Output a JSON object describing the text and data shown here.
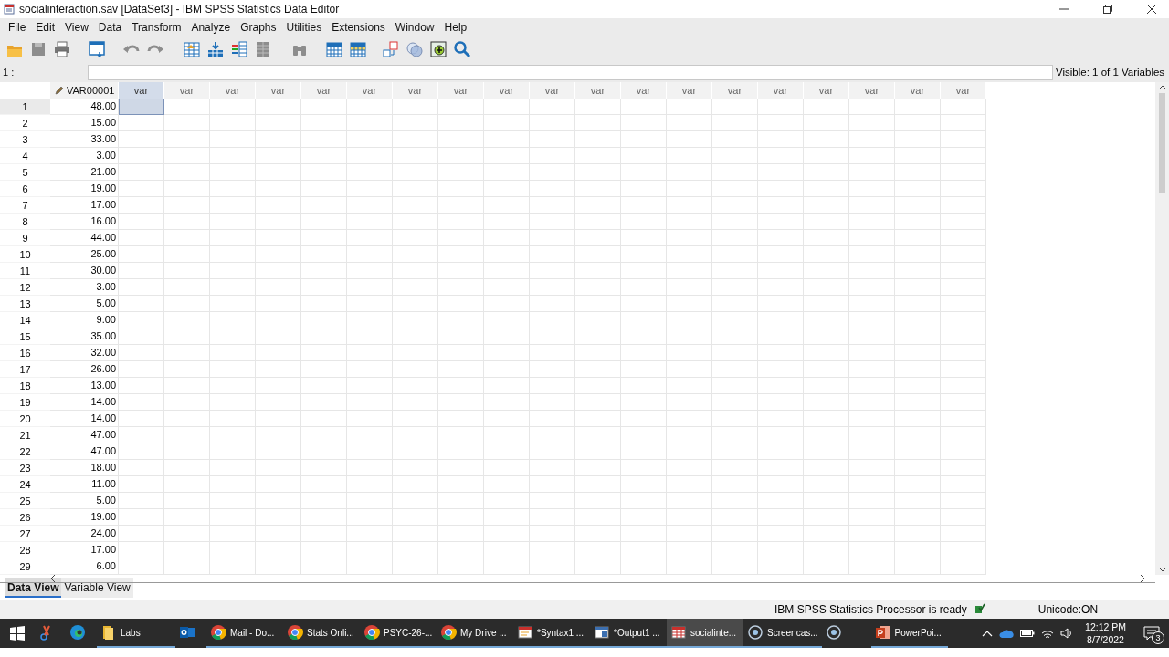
{
  "window": {
    "title": "socialinteraction.sav [DataSet3] - IBM SPSS Statistics Data Editor"
  },
  "menu": [
    "File",
    "Edit",
    "View",
    "Data",
    "Transform",
    "Analyze",
    "Graphs",
    "Utilities",
    "Extensions",
    "Window",
    "Help"
  ],
  "cell_editor": {
    "label": "1 :",
    "visible_count": "Visible: 1 of 1 Variables"
  },
  "grid": {
    "columns": [
      {
        "label": "VAR00001",
        "kind": "variable",
        "selected": false
      },
      {
        "label": "var",
        "kind": "empty",
        "selected": true
      },
      {
        "label": "var",
        "kind": "empty",
        "selected": false
      },
      {
        "label": "var",
        "kind": "empty",
        "selected": false
      },
      {
        "label": "var",
        "kind": "empty",
        "selected": false
      },
      {
        "label": "var",
        "kind": "empty",
        "selected": false
      },
      {
        "label": "var",
        "kind": "empty",
        "selected": false
      },
      {
        "label": "var",
        "kind": "empty",
        "selected": false
      },
      {
        "label": "var",
        "kind": "empty",
        "selected": false
      },
      {
        "label": "var",
        "kind": "empty",
        "selected": false
      },
      {
        "label": "var",
        "kind": "empty",
        "selected": false
      },
      {
        "label": "var",
        "kind": "empty",
        "selected": false
      },
      {
        "label": "var",
        "kind": "empty",
        "selected": false
      },
      {
        "label": "var",
        "kind": "empty",
        "selected": false
      },
      {
        "label": "var",
        "kind": "empty",
        "selected": false
      },
      {
        "label": "var",
        "kind": "empty",
        "selected": false
      },
      {
        "label": "var",
        "kind": "empty",
        "selected": false
      },
      {
        "label": "var",
        "kind": "empty",
        "selected": false
      },
      {
        "label": "var",
        "kind": "empty",
        "selected": false
      },
      {
        "label": "var",
        "kind": "empty",
        "selected": false
      }
    ],
    "rows": [
      {
        "number": "1",
        "value": "48.00",
        "selected": true
      },
      {
        "number": "2",
        "value": "15.00",
        "selected": false
      },
      {
        "number": "3",
        "value": "33.00",
        "selected": false
      },
      {
        "number": "4",
        "value": "3.00",
        "selected": false
      },
      {
        "number": "5",
        "value": "21.00",
        "selected": false
      },
      {
        "number": "6",
        "value": "19.00",
        "selected": false
      },
      {
        "number": "7",
        "value": "17.00",
        "selected": false
      },
      {
        "number": "8",
        "value": "16.00",
        "selected": false
      },
      {
        "number": "9",
        "value": "44.00",
        "selected": false
      },
      {
        "number": "10",
        "value": "25.00",
        "selected": false
      },
      {
        "number": "11",
        "value": "30.00",
        "selected": false
      },
      {
        "number": "12",
        "value": "3.00",
        "selected": false
      },
      {
        "number": "13",
        "value": "5.00",
        "selected": false
      },
      {
        "number": "14",
        "value": "9.00",
        "selected": false
      },
      {
        "number": "15",
        "value": "35.00",
        "selected": false
      },
      {
        "number": "16",
        "value": "32.00",
        "selected": false
      },
      {
        "number": "17",
        "value": "26.00",
        "selected": false
      },
      {
        "number": "18",
        "value": "13.00",
        "selected": false
      },
      {
        "number": "19",
        "value": "14.00",
        "selected": false
      },
      {
        "number": "20",
        "value": "14.00",
        "selected": false
      },
      {
        "number": "21",
        "value": "47.00",
        "selected": false
      },
      {
        "number": "22",
        "value": "47.00",
        "selected": false
      },
      {
        "number": "23",
        "value": "18.00",
        "selected": false
      },
      {
        "number": "24",
        "value": "11.00",
        "selected": false
      },
      {
        "number": "25",
        "value": "5.00",
        "selected": false
      },
      {
        "number": "26",
        "value": "19.00",
        "selected": false
      },
      {
        "number": "27",
        "value": "24.00",
        "selected": false
      },
      {
        "number": "28",
        "value": "17.00",
        "selected": false
      },
      {
        "number": "29",
        "value": "6.00",
        "selected": false
      }
    ]
  },
  "view_tabs": [
    {
      "label": "Data View",
      "selected": true
    },
    {
      "label": "Variable View",
      "selected": false
    }
  ],
  "status_bar": {
    "processor": "IBM SPSS Statistics Processor is ready",
    "unicode": "Unicode:ON"
  },
  "taskbar": {
    "items": [
      {
        "kind": "snip",
        "selected": false
      },
      {
        "kind": "edge",
        "selected": false
      },
      {
        "kind": "folder",
        "label": "Labs",
        "selected": false
      },
      {
        "kind": "outlook",
        "selected": false
      },
      {
        "kind": "chrome",
        "label": "Mail - Do...",
        "selected": false
      },
      {
        "kind": "chrome",
        "label": "Stats Onli...",
        "selected": false
      },
      {
        "kind": "chrome",
        "label": "PSYC-26-...",
        "selected": false
      },
      {
        "kind": "chrome",
        "label": "My Drive ...",
        "selected": false
      },
      {
        "kind": "syntax",
        "label": "*Syntax1 ...",
        "selected": false
      },
      {
        "kind": "output",
        "label": "*Output1 ...",
        "selected": false
      },
      {
        "kind": "data",
        "label": "socialinte...",
        "selected": true
      },
      {
        "kind": "record",
        "label": "Screencas...",
        "selected": false
      },
      {
        "kind": "record",
        "selected": false
      },
      {
        "kind": "powerpoint",
        "label": "PowerPoi...",
        "selected": false
      }
    ],
    "time": "12:12 PM",
    "date": "8/7/2022",
    "notifications": "3"
  }
}
